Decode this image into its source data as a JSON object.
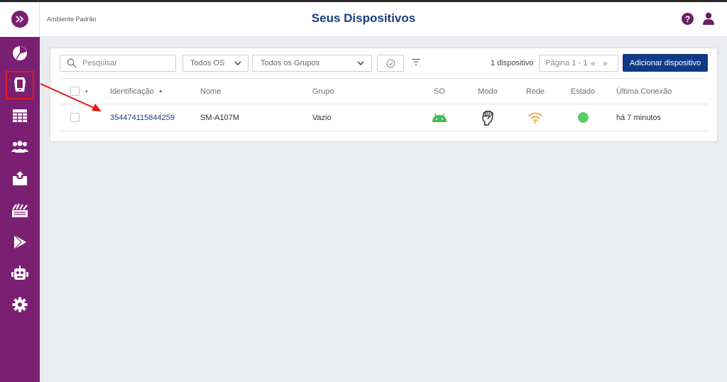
{
  "app": {
    "environment": "Ambiente Padrão",
    "title": "Seus Dispositivos",
    "help_glyph": "?"
  },
  "colors": {
    "sidebar_bg": "#7b1f72",
    "title": "#1b3f82",
    "primary_button": "#113a85",
    "link": "#1b3f82",
    "status_online": "#5ecb6b",
    "android_green": "#3fba54",
    "wifi_orange": "#f2a33a",
    "annotation_red": "#e01b1b"
  },
  "sidebar": {
    "items": [
      {
        "name": "dashboard",
        "icon": "pie-chart-icon"
      },
      {
        "name": "devices",
        "icon": "device-icon",
        "highlighted": true
      },
      {
        "name": "reports",
        "icon": "table-icon"
      },
      {
        "name": "groups",
        "icon": "users-icon"
      },
      {
        "name": "files",
        "icon": "upload-box-icon"
      },
      {
        "name": "apps",
        "icon": "app-store-icon"
      },
      {
        "name": "play-store",
        "icon": "play-icon"
      },
      {
        "name": "automation",
        "icon": "robot-icon"
      },
      {
        "name": "settings",
        "icon": "gear-icon"
      }
    ]
  },
  "toolbar": {
    "search_placeholder": "Pesquisar",
    "os_filter": "Todos OS",
    "group_filter": "Todos os Grupos",
    "device_count": "1 dispositivo",
    "pagination": "Página 1 - 1",
    "pager_arrows": "◀ ▶",
    "add_button": "Adicionar dispositivo"
  },
  "table": {
    "sort_dropdown": "▾",
    "sort_indicator": "▲",
    "columns": {
      "id": "Identificação",
      "name": "Nome",
      "group": "Grupo",
      "os": "SO",
      "mode": "Modo",
      "network": "Rede",
      "status": "Estado",
      "last_connection": "Última Conexão"
    },
    "rows": [
      {
        "id": "354474115844259",
        "name": "SM-A107M",
        "group": "Vazio",
        "os_icon": "android-icon",
        "mode_icon": "fist-icon",
        "network_icon": "wifi-icon",
        "status": "online",
        "last_connection": "há 7 minutos"
      }
    ]
  }
}
